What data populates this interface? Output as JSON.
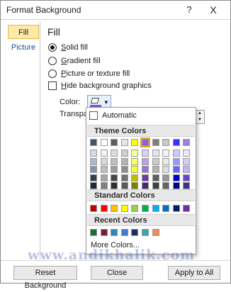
{
  "window": {
    "title": "Format Background",
    "help_glyph": "?",
    "close_glyph": "X"
  },
  "sidebar": {
    "items": [
      {
        "label": "Fill"
      },
      {
        "label": "Picture"
      }
    ]
  },
  "fill": {
    "section_title": "Fill",
    "options": [
      {
        "label": "Solid fill",
        "accel": "S",
        "rest": "olid fill",
        "checked": true
      },
      {
        "label": "Gradient fill",
        "accel": "G",
        "rest": "radient fill",
        "checked": false
      },
      {
        "label": "Picture or texture fill",
        "accel": "P",
        "rest": "icture or texture fill",
        "checked": false
      }
    ],
    "hide_graphics": {
      "label": "Hide background graphics",
      "accel": "H",
      "rest": "ide background graphics",
      "checked": false
    },
    "color_label": "Color:",
    "color_accent": "#7b55c5",
    "transparency_label": "Transpa"
  },
  "palette": {
    "automatic_label": "Automatic",
    "theme_header": "Theme Colors",
    "theme_top_row": [
      "#ffffff",
      "#000000",
      "#eeece1",
      "#1f497d",
      "#4f81bd",
      "#c0504d",
      "#9bbb59",
      "#8064a2",
      "#4bacc6",
      "#f79646"
    ],
    "theme_top_row_actual": [
      "#44546a",
      "#ffffff",
      "#5f5f5f",
      "#e5e5e5",
      "#ffff00",
      "#8e63d1",
      "#7f7f7f",
      "#c8c8c8",
      "#3333ff",
      "#9b85e0"
    ],
    "theme_shade_columns": [
      [
        "#d6dbe3",
        "#adb9ca",
        "#8497b0",
        "#333f4f",
        "#222a35"
      ],
      [
        "#f2f2f2",
        "#d9d9d9",
        "#bfbfbf",
        "#a6a6a6",
        "#808080"
      ],
      [
        "#dedede",
        "#bfbfbf",
        "#9e9e9e",
        "#474747",
        "#303030"
      ],
      [
        "#cfcfcf",
        "#b3b3b3",
        "#8f8f8f",
        "#737373",
        "#595959"
      ],
      [
        "#ffff99",
        "#ffff66",
        "#ffff33",
        "#bfbf00",
        "#7f7f00"
      ],
      [
        "#ddd0f1",
        "#bba1e3",
        "#9c72d6",
        "#6a3cab",
        "#472872"
      ],
      [
        "#e5e5e5",
        "#cccccc",
        "#b2b2b2",
        "#5f5f5f",
        "#3f3f3f"
      ],
      [
        "#f4f4f4",
        "#e9e9e9",
        "#dedede",
        "#969696",
        "#646464"
      ],
      [
        "#ccccff",
        "#9999ff",
        "#6666ff",
        "#0000cc",
        "#000088"
      ],
      [
        "#ebe6f8",
        "#d7cdf2",
        "#c3b5ec",
        "#6647c8",
        "#443085"
      ]
    ],
    "selected_index": 5,
    "standard_header": "Standard Colors",
    "standard": [
      "#c00000",
      "#ff0000",
      "#ffc000",
      "#ffff00",
      "#92d050",
      "#00b050",
      "#00b0f0",
      "#0070c0",
      "#002060",
      "#7030a0"
    ],
    "recent_header": "Recent Colors",
    "recent": [
      "#1e6b3a",
      "#7a1c3d",
      "#2e86c1",
      "#3d7bd1",
      "#1f2d5c",
      "#39a6a8",
      "#f28b5b"
    ],
    "more_colors_label": "More Colors..."
  },
  "watermark": "www.andikhalik.com",
  "footer": {
    "reset_label": "Reset Background",
    "close_label": "Close",
    "apply_label": "Apply to All"
  }
}
